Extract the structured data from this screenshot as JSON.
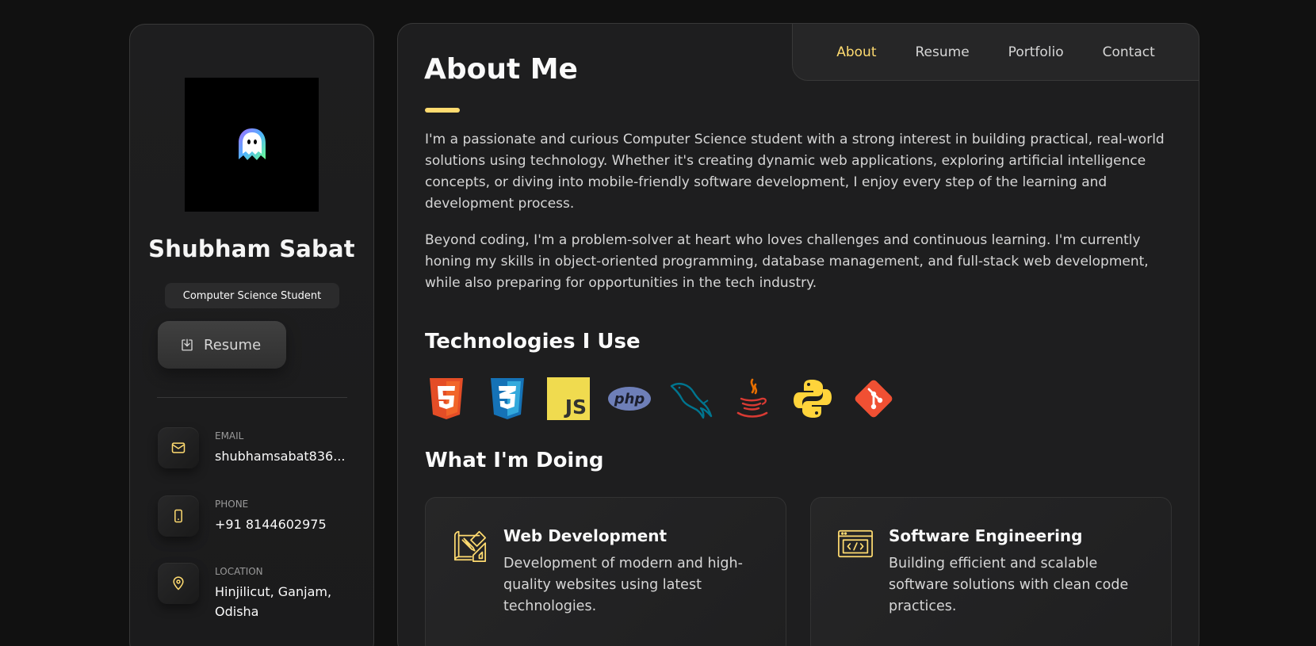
{
  "sidebar": {
    "name": "Shubham Sabat",
    "title": "Computer Science Student",
    "resume_label": "Resume",
    "contacts": [
      {
        "label": "Email",
        "value": "shubhamsabat836...",
        "icon": "mail-icon"
      },
      {
        "label": "Phone",
        "value": "+91 8144602975",
        "icon": "phone-icon"
      },
      {
        "label": "Location",
        "value": "Hinjilicut, Ganjam, Odisha",
        "icon": "location-pin-icon"
      }
    ]
  },
  "nav": {
    "items": [
      "About",
      "Resume",
      "Portfolio",
      "Contact"
    ],
    "active": "About"
  },
  "about": {
    "heading": "About Me",
    "paragraphs": [
      "I'm a passionate and curious Computer Science student with a strong interest in building practical, real-world solutions using technology. Whether it's creating dynamic web applications, exploring artificial intelligence concepts, or diving into mobile-friendly software development, I enjoy every step of the learning and development process.",
      "Beyond coding, I'm a problem-solver at heart who loves challenges and continuous learning. I'm currently honing my skills in object-oriented programming, database management, and full-stack web development, while also preparing for opportunities in the tech industry."
    ]
  },
  "technologies": {
    "heading": "Technologies I Use",
    "items": [
      "html5-icon",
      "css3-icon",
      "javascript-icon",
      "php-icon",
      "mysql-icon",
      "java-icon",
      "python-icon",
      "git-icon"
    ],
    "js_text": "JS",
    "php_text": "php"
  },
  "services": {
    "heading": "What I'm Doing",
    "items": [
      {
        "title": "Web Development",
        "desc": "Development of modern and high-quality websites using latest technologies.",
        "icon": "design-tools-icon"
      },
      {
        "title": "Software Engineering",
        "desc": "Building efficient and scalable software solutions with clean code practices.",
        "icon": "code-window-icon"
      }
    ]
  },
  "colors": {
    "accent": "#ffdb70",
    "background": "#111111",
    "card": "#1e1e1f"
  }
}
